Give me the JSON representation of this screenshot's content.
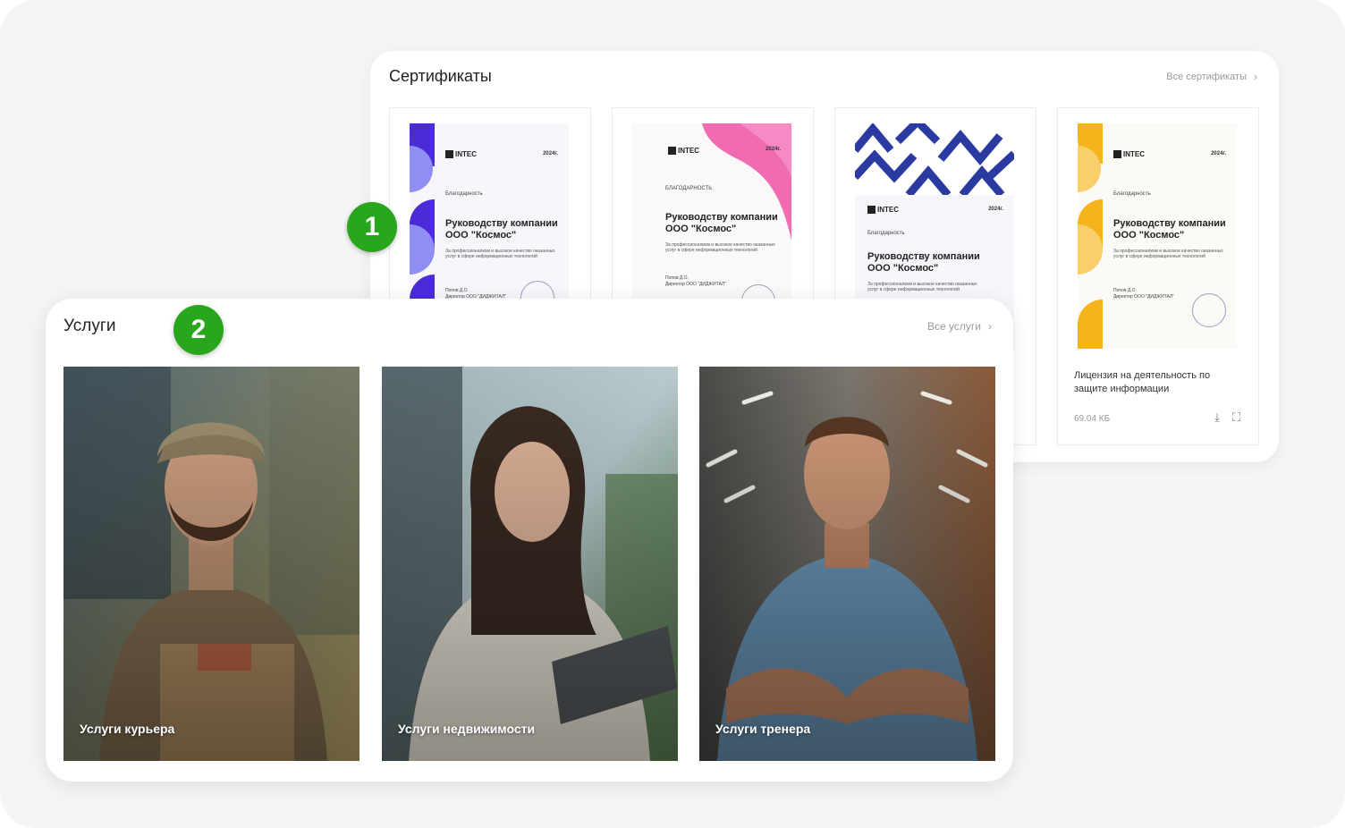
{
  "certificates": {
    "title": "Сертификаты",
    "all_link": "Все сертификаты",
    "items": [
      {
        "doc": {
          "logo": "INTEC",
          "year": "2024г.",
          "kind": "Благодарность",
          "heading": "Руководству компании ООО \"Космос\"",
          "text": "За профессионализм и высокое качество оказанных услуг в сфере информационных технологий",
          "signer": "Попов Д.О.",
          "signer_role": "Директор ООО \"ДИДЖИТАЛ\""
        },
        "accent": "#4b2bd6"
      },
      {
        "doc": {
          "logo": "INTEC",
          "year": "2024г.",
          "kind": "БЛАГОДАРНОСТЬ",
          "heading": "Руководству компании ООО \"Космос\"",
          "text": "За профессионализм и высокое качество оказанных услуг в сфере информационных технологий",
          "signer": "Попов Д.О.",
          "signer_role": "Директор ООО \"ДИДЖИТАЛ\""
        },
        "accent": "#f06bb0"
      },
      {
        "doc": {
          "logo": "INTEC",
          "year": "2024г.",
          "kind": "Благодарность",
          "heading": "Руководству компании ООО \"Космос\"",
          "text": "За профессионализм и высокое качество оказанных услуг в сфере информационных технологий",
          "signer": "",
          "signer_role": ""
        },
        "accent": "#2a3aa0"
      },
      {
        "doc": {
          "logo": "INTEC",
          "year": "2024г.",
          "kind": "Благодарность",
          "heading": "Руководству компании ООО \"Космос\"",
          "text": "За профессионализм и высокое качество оказанных услуг в сфере информационных технологий",
          "signer": "Попов Д.О.",
          "signer_role": "Директор ООО \"ДИДЖИТАЛ\""
        },
        "accent": "#f5b31c",
        "caption": "Лицензия на деятельность по защите информации",
        "size": "69.04 КБ",
        "icons": [
          "download-icon",
          "fullscreen-icon"
        ]
      }
    ]
  },
  "badges": [
    "1",
    "2"
  ],
  "services": {
    "title": "Услуги",
    "all_link": "Все услуги",
    "items": [
      {
        "label": "Услуги курьера"
      },
      {
        "label": "Услуги недвижимости"
      },
      {
        "label": "Услуги тренера"
      }
    ]
  },
  "colors": {
    "badge": "#28a71c",
    "panel_bg": "#f5f5f6"
  }
}
